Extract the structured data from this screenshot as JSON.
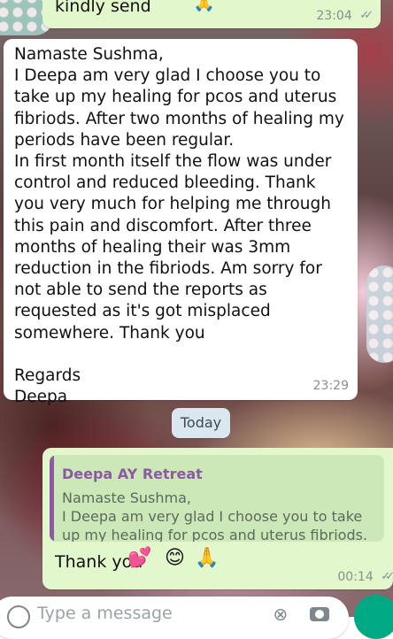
{
  "chat": {
    "prev_message": {
      "text": "kindly send",
      "emoji": "🙏",
      "time": "23:04",
      "read_ticks": "✓✓"
    },
    "incoming_message": {
      "text": "Namaste Sushma,\nI Deepa am very glad I choose you to take up my healing for pcos and uterus fibriods. After two months of healing my periods have been regular.\nIn first month itself the flow was under control and reduced bleeding. Thank you very much for helping me through this pain and discomfort. After three months of healing their was 3mm reduction in the fibriods. Am sorry for not able to send the reports as requested as it's got misplaced somewhere. Thank you\n\nRegards\nDeepa",
      "time": "23:29"
    },
    "date_divider": "Today",
    "reply_message": {
      "quoted_author": "Deepa AY Retreat",
      "quoted_text": "Namaste Sushma,\nI Deepa am very glad I choose you to take up my healing for pcos and uterus fibriods. Aft...",
      "text": "Thank you",
      "emojis": [
        "💕",
        "😊",
        "🙏"
      ],
      "time": "00:14",
      "read_ticks": "✓✓"
    }
  },
  "composer": {
    "placeholder": "Type a message"
  },
  "icons": {
    "emoji": "emoji-icon",
    "attach": "paperclip-icon",
    "camera": "camera-icon",
    "mic": "mic-icon"
  },
  "colors": {
    "outgoing_bubble": "#e2f7cb",
    "incoming_bubble": "#ffffff",
    "quote_author": "#8b5aa3",
    "accent": "#00a884"
  }
}
